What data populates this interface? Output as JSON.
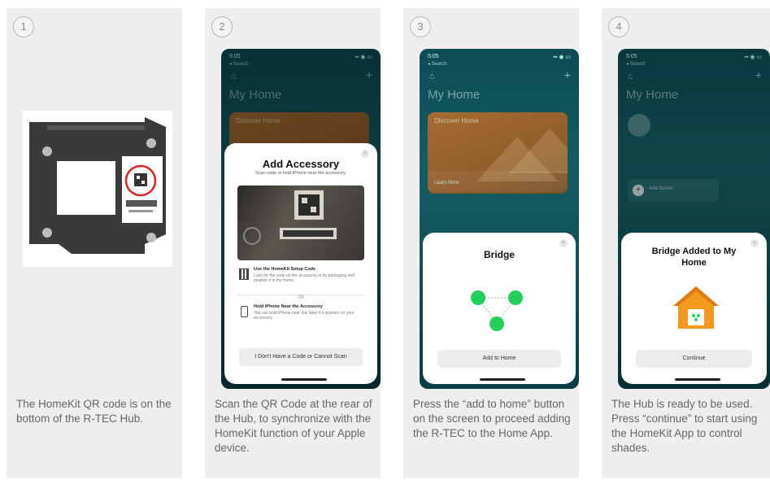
{
  "steps": [
    {
      "number": "1",
      "description": "The HomeKit QR code is on the bottom of the R-TEC Hub."
    },
    {
      "number": "2",
      "description": "Scan the QR Code at the rear of the Hub, to synchronize with the HomeKit function of your Apple device.",
      "phone": {
        "time": "5:05",
        "back": "◂ Search",
        "title": "My Home",
        "discover_title": "Discover Home",
        "sheet": {
          "title": "Add Accessory",
          "subtitle": "Scan code or hold iPhone near the accessory.",
          "option1_title": "Use the HomeKit Setup Code",
          "option1_text": "Look for the code on the accessory or its packaging and position it in the frame.",
          "or": "OR",
          "option2_title": "Hold iPhone Near the Accessory",
          "option2_text": "You can hold iPhone near this label if it appears on your accessory.",
          "button": "I Don't Have a Code or Cannot Scan"
        }
      }
    },
    {
      "number": "3",
      "description": "Press the “add to home” button on the screen to proceed adding the R-TEC to the Home App.",
      "phone": {
        "time": "5:05",
        "back": "◂ Search",
        "title": "My Home",
        "discover_title": "Discover Home",
        "learn_more": "Learn More",
        "sheet_title": "Bridge",
        "button": "Add to Home"
      }
    },
    {
      "number": "4",
      "description": "The Hub is ready to be used. Press “continue” to start using the HomeKit App to control shades.",
      "phone": {
        "time": "5:05",
        "back": "◂ Search",
        "title": "My Home",
        "add_scene": "Add Scene",
        "sheet_title": "Bridge Added to My Home",
        "button": "Continue"
      }
    }
  ],
  "colors": {
    "panel_bg": "#eeeeee",
    "phone_teal": "#145d63",
    "node_green": "#22d05a",
    "house_orange": "#f39a1e"
  }
}
